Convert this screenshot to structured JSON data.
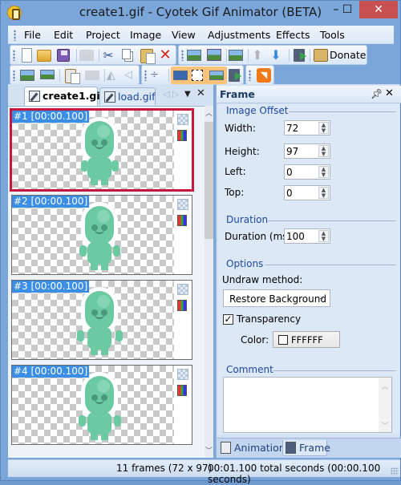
{
  "window": {
    "title": "create1.gif - Cyotek Gif Animator (BETA)",
    "minimize": "–",
    "maximize": "☐",
    "close": "✕"
  },
  "menu": [
    "File",
    "Edit",
    "Project",
    "Image",
    "View",
    "Adjustments",
    "Effects",
    "Tools"
  ],
  "toolbar1": {
    "buttons": [
      "new-document",
      "open-folder",
      "save",
      "print",
      "cut",
      "copy",
      "paste",
      "delete",
      "save-image",
      "save-all-images",
      "add-image",
      "move-up",
      "move-down",
      "play-animation",
      "donate"
    ],
    "donate_label": "Donate"
  },
  "toolbar2": {
    "buttons": [
      "edit-image",
      "adjust-colors",
      "frame-properties",
      "tile-frames",
      "flip-horizontal",
      "flip-vertical",
      "insert-separator",
      "show-labels",
      "show-transparency",
      "show-details",
      "film-favorite",
      "rss-feed"
    ]
  },
  "documents": {
    "tabs": [
      {
        "label": "create1.gif",
        "active": true
      },
      {
        "label": "load.gif",
        "active": false
      }
    ]
  },
  "frames": [
    {
      "label": "#1 [00:00.100]",
      "selected": true
    },
    {
      "label": "#2 [00:00.100]",
      "selected": false
    },
    {
      "label": "#3 [00:00.100]",
      "selected": false
    },
    {
      "label": "#4 [00:00.100]",
      "selected": false
    }
  ],
  "panel": {
    "title": "Frame",
    "image_offset": {
      "title": "Image Offset",
      "width_label": "Width:",
      "width": "72",
      "height_label": "Height:",
      "height": "97",
      "left_label": "Left:",
      "left": "0",
      "top_label": "Top:",
      "top": "0"
    },
    "duration": {
      "title": "Duration",
      "label": "Duration (ms):",
      "value": "100"
    },
    "options": {
      "title": "Options",
      "undraw_label": "Undraw method:",
      "undraw_value": "Restore Background",
      "transparency_label": "Transparency",
      "transparency_checked": true,
      "color_label": "Color:",
      "color_value": "FFFFFF",
      "color_swatch": "#FFFFFF"
    },
    "comment": {
      "title": "Comment",
      "value": ""
    },
    "bottom_tabs": [
      {
        "label": "Animation",
        "active": false
      },
      {
        "label": "Frame",
        "active": true
      }
    ]
  },
  "status": {
    "frames": "11 frames (72 x 97)",
    "time": "00:01.100 total seconds (00:00.100 seconds)"
  },
  "colors": {
    "selection_border": "#C8173E",
    "label_bg": "#3A8EE6",
    "alien": "#6CCAA2"
  }
}
